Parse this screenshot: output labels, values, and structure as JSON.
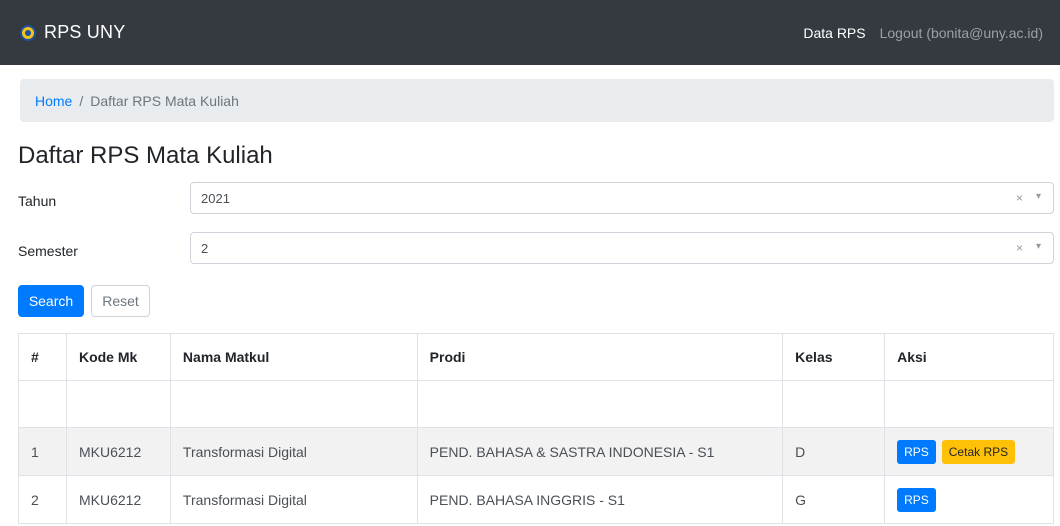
{
  "navbar": {
    "brand": "RPS UNY",
    "links": {
      "data_rps": "Data RPS",
      "logout": "Logout (bonita@uny.ac.id)"
    }
  },
  "breadcrumb": {
    "home": "Home",
    "separator": "/",
    "current": "Daftar RPS Mata Kuliah"
  },
  "page": {
    "title": "Daftar RPS Mata Kuliah"
  },
  "filters": {
    "tahun": {
      "label": "Tahun",
      "value": "2021"
    },
    "semester": {
      "label": "Semester",
      "value": "2"
    },
    "clear_glyph": "×",
    "caret_glyph": "▾"
  },
  "actions": {
    "search": "Search",
    "reset": "Reset"
  },
  "table": {
    "headers": [
      "#",
      "Kode Mk",
      "Nama Matkul",
      "Prodi",
      "Kelas",
      "Aksi"
    ],
    "rows": [
      {
        "no": "1",
        "kode": "MKU6212",
        "nama": "Transformasi Digital",
        "prodi": "PEND. BAHASA & SASTRA INDONESIA - S1",
        "kelas": "D",
        "rps": "RPS",
        "cetak": "Cetak RPS"
      },
      {
        "no": "2",
        "kode": "MKU6212",
        "nama": "Transformasi Digital",
        "prodi": "PEND. BAHASA INGGRIS - S1",
        "kelas": "G",
        "rps": "RPS"
      }
    ]
  },
  "colors": {
    "navbar": "#343a40",
    "primary": "#007bff",
    "warning": "#ffc107",
    "breadcrumb_bg": "#e9ecef"
  },
  "icons": {
    "brand_logo": "uny-logo-icon",
    "clear": "clear-icon",
    "caret": "chevron-down-icon"
  }
}
